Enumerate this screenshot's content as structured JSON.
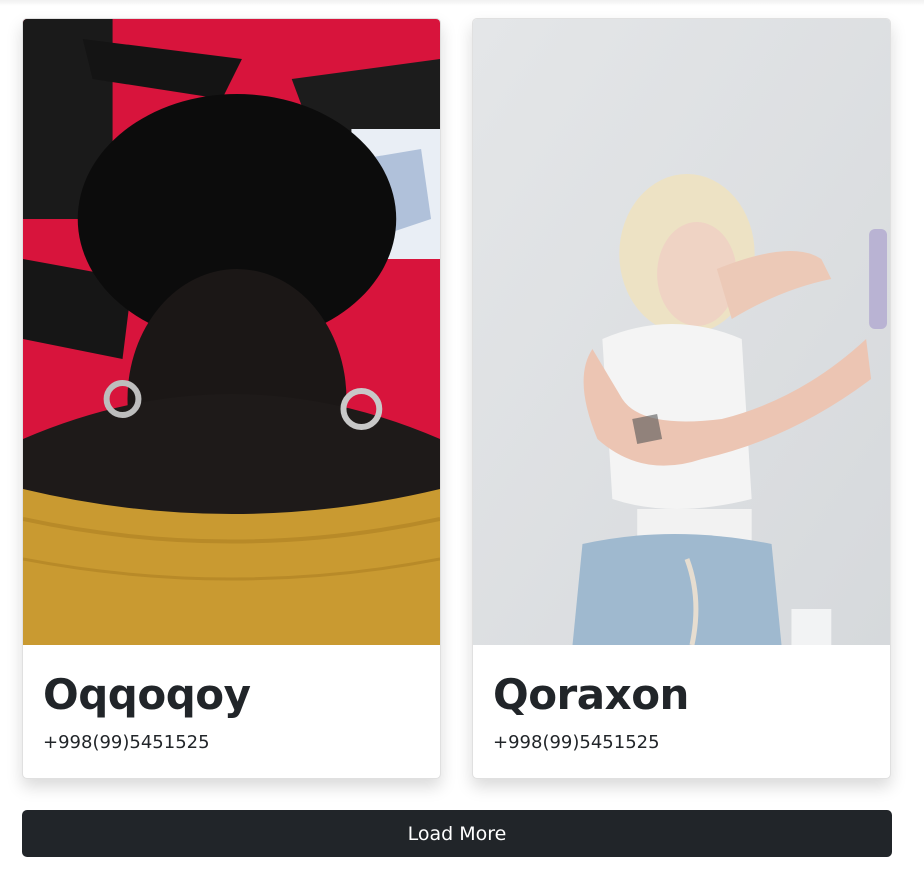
{
  "cards": [
    {
      "title": "Oqqoqoy",
      "phone": "+998(99)5451525",
      "image": "portrait-woman-afro-yellow-top"
    },
    {
      "title": "Qoraxon",
      "phone": "+998(99)5451525",
      "image": "portrait-woman-blonde-selfie"
    }
  ],
  "load_more": {
    "label": "Load More"
  },
  "colors": {
    "button_bg": "#212529",
    "text": "#212529"
  }
}
